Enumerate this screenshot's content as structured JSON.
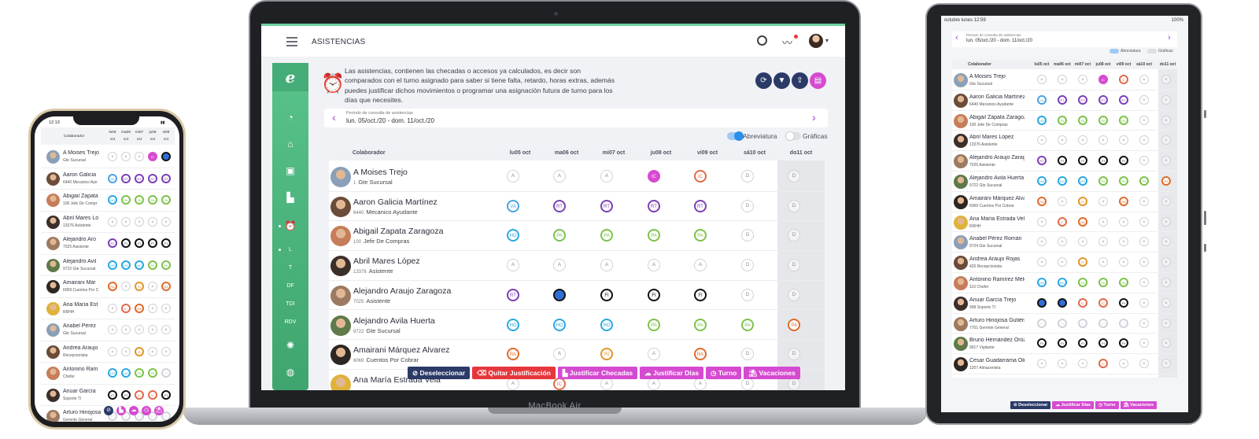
{
  "laptop": {
    "brand_label": "MacBook Air",
    "title": "ASISTENCIAS",
    "description": "Las asistencias, contienen las checadas o accesos ya calculados, es decir son comparados con el turno asignado para saber si tiene falta, retardo, horas extras, además puedes justificar dichos movimientos o programar una asignación futura de turno para los días que necesites.",
    "period_label": "Periodo de consulta de asistencias",
    "period_value": "lun. 05/oct./20 - dom. 11/oct./20",
    "toggle_abreviatura": "Abreviatura",
    "toggle_graficas": "Gráficas",
    "sidebar_labels": [
      "L",
      "T",
      "DF",
      "TDI",
      "RDV"
    ],
    "columns": [
      "Colaborador",
      "lu05 oct",
      "ma06 oct",
      "mi07 oct",
      "ju08 oct",
      "vi09 oct",
      "sá10 oct",
      "do11 oct"
    ],
    "rows": [
      {
        "name": "A Moises Trejo",
        "num": "1",
        "pos": "Gte Sucursal",
        "codes": [
          "A",
          "A",
          "A",
          "IC",
          "IC",
          "D",
          "D"
        ]
      },
      {
        "name": "Aaron Galicia Martínez",
        "num": "6440",
        "pos": "Mecanico Ayudante",
        "codes": [
          "VA",
          "RT",
          "RT",
          "RT",
          "RT",
          "D",
          "D"
        ]
      },
      {
        "name": "Abigail Zapata Zaragoza",
        "num": "100",
        "pos": "Jefe De Compras",
        "codes": [
          "HO",
          "PA",
          "PA",
          "PA",
          "PA",
          "D",
          "D"
        ]
      },
      {
        "name": "Abril Mares López",
        "num": "13376",
        "pos": "Asistente",
        "codes": [
          "A",
          "A",
          "A",
          "A",
          "A",
          "D",
          "D"
        ]
      },
      {
        "name": "Alejandro Araujo Zaragoza",
        "num": "7025",
        "pos": "Asistente",
        "codes": [
          "RT",
          "",
          "FI",
          "FI",
          "FI",
          "D",
          "D"
        ]
      },
      {
        "name": "Alejandro Avila Huerta",
        "num": "9722",
        "pos": "Gte Sucursal",
        "codes": [
          "HO",
          "HO",
          "HO",
          "PA",
          "PA",
          "PA",
          "P4"
        ]
      },
      {
        "name": "Amairani Márquez Alvarez",
        "num": "6069",
        "pos": "Cuentos Por Cobrar",
        "codes": [
          "RA",
          "A",
          "RI",
          "A",
          "RA",
          "D",
          "D"
        ]
      },
      {
        "name": "Ana María Estrada Vela",
        "num": "",
        "pos": "",
        "codes": [
          "A",
          "IC",
          "A",
          "A",
          "A",
          "D",
          "D"
        ]
      }
    ],
    "bulk_actions": [
      "Deseleccionar",
      "Quitar Justificación",
      "Justificar Checadas",
      "Justificar Días",
      "Turno",
      "Vacaciones"
    ]
  },
  "phone": {
    "time": "12:13",
    "header_col": "Colaborador",
    "day_cols": [
      "lu05 oct",
      "ma06 oct",
      "mi07 oct",
      "ju08 oct",
      "vi09 oct"
    ],
    "rows": [
      {
        "name": "A Moises Trejo",
        "pos": "Gte Sucursal"
      },
      {
        "name": "Aaron Galicia",
        "pos": "6440 Mecanico Aye"
      },
      {
        "name": "Abigail Zapata",
        "pos": "100 Jefe De Compr"
      },
      {
        "name": "Abril Mares Ló",
        "pos": "13376 Asistente"
      },
      {
        "name": "Alejandro Aro",
        "pos": "7025 Asistente"
      },
      {
        "name": "Alejandro Avil",
        "pos": "9722 Gte Sucursal"
      },
      {
        "name": "Amairani Már",
        "pos": "6069 Cuentos Por C"
      },
      {
        "name": "Ana María Est",
        "pos": "RRHH"
      },
      {
        "name": "Anabel Pérez",
        "pos": "Gte Sucursal"
      },
      {
        "name": "Andrea Araujo",
        "pos": "Recepcionista"
      },
      {
        "name": "Antonino Ram",
        "pos": "Chofer"
      },
      {
        "name": "Anuar García",
        "pos": "Soporte TI"
      },
      {
        "name": "Arturo Hinojosa",
        "pos": "Gerente General"
      }
    ]
  },
  "tablet": {
    "status_left": "octubre lunes 12:59",
    "status_right": "100%",
    "period_label": "Periodo de consulta de asistencias",
    "period_value": "lun. 05/oct./20 - dom. 11/oct./20",
    "toggle_abreviatura": "Abreviatura",
    "toggle_graficas": "Gráficas",
    "columns": [
      "Colaborador",
      "lu05 oct",
      "ma06 oct",
      "mi07 oct",
      "ju08 oct",
      "vi09 oct",
      "sá10 oct",
      "do11 oct"
    ],
    "rows": [
      {
        "name": "A Moises Trejo",
        "pos": "Gte Sucursal"
      },
      {
        "name": "Aaron Galicia Martínez",
        "pos": "6440 Mecanico Ayudante"
      },
      {
        "name": "Abigail Zapata Zaragoza",
        "pos": "100 Jefe De Compras"
      },
      {
        "name": "Abril Mares López",
        "pos": "13376 Asistente"
      },
      {
        "name": "Alejandro Araujo Zaragoza",
        "pos": "7025 Asistente"
      },
      {
        "name": "Alejandro Avila Huerta",
        "pos": "9722 Gte Sucursal"
      },
      {
        "name": "Amairani Márquez Alvarez",
        "pos": "6069 Cuentos Por Cobrar"
      },
      {
        "name": "Ana María Estrada Vela",
        "pos": "RRHH"
      },
      {
        "name": "Anabel Pérez Román",
        "pos": "9724 Gte Sucursal"
      },
      {
        "name": "Andrea Araujo Rojas",
        "pos": "420 Recepcionista"
      },
      {
        "name": "Antonino Ramírez Melgoza",
        "pos": "110 Chofer"
      },
      {
        "name": "Anuar García Trejo",
        "pos": "998 Soporte TI"
      },
      {
        "name": "Arturo Hinojosa Gutiérrez",
        "pos": "7701 Gerente General"
      },
      {
        "name": "Bruno Hernández Orozco",
        "pos": "9917 Vigilante"
      },
      {
        "name": "Cesar Guadarrama Oliva",
        "pos": "1207 Almacenista"
      }
    ],
    "bulk_actions": [
      "Deseleccionar",
      "Justificar Días",
      "Turno",
      "Vacaciones"
    ]
  },
  "colors": {
    "green": "#4db57f",
    "purple": "#9c3fd6",
    "navy": "#2b3a67",
    "red": "#e5363c",
    "magenta": "#d64ad1"
  }
}
